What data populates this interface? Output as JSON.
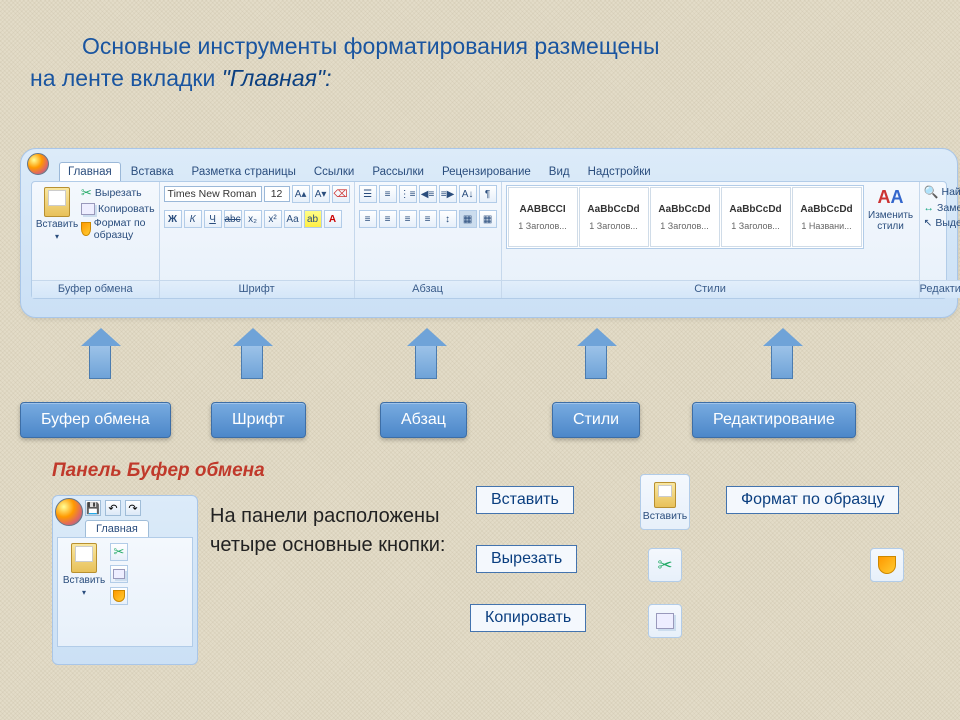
{
  "intro": {
    "line1": "Основные инструменты форматирования размещены",
    "line2_prefix": "на ленте вкладки ",
    "line2_emph": "\"Главная\":"
  },
  "tabs": [
    "Главная",
    "Вставка",
    "Разметка страницы",
    "Ссылки",
    "Рассылки",
    "Рецензирование",
    "Вид",
    "Надстройки"
  ],
  "clipboard": {
    "paste": "Вставить",
    "cut": "Вырезать",
    "copy": "Копировать",
    "format_painter": "Формат по образцу",
    "group_label": "Буфер обмена"
  },
  "font": {
    "name": "Times New Roman",
    "size": "12",
    "group_label": "Шрифт"
  },
  "paragraph": {
    "group_label": "Абзац"
  },
  "styles_group": {
    "group_label": "Стили",
    "change_styles": "Изменить\nстили",
    "items": [
      {
        "sample": "AABBCCI",
        "name": "1 Заголов..."
      },
      {
        "sample": "AaBbCcDd",
        "name": "1 Заголов..."
      },
      {
        "sample": "AaBbCcDd",
        "name": "1 Заголов..."
      },
      {
        "sample": "AaBbCcDd",
        "name": "1 Заголов..."
      },
      {
        "sample": "AaBbCcDd",
        "name": "1 Названи..."
      }
    ]
  },
  "editing": {
    "find": "Найти",
    "replace": "Заменить",
    "select": "Выделить",
    "group_label": "Редактирование"
  },
  "callouts": [
    "Буфер обмена",
    "Шрифт",
    "Абзац",
    "Стили",
    "Редактирование"
  ],
  "subtitle": "Панель Буфер обмена",
  "paragraph_text": "На панели расположены четыре основные кнопки:",
  "mini": {
    "tab": "Главная",
    "paste": "Вставить"
  },
  "labels": {
    "paste": "Вставить",
    "cut": "Вырезать",
    "copy": "Копировать",
    "format_painter": "Формат по образцу"
  }
}
